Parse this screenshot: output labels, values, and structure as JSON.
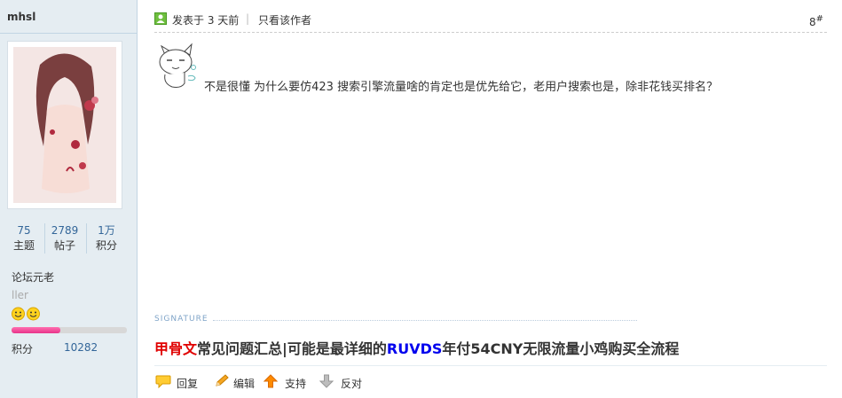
{
  "user": {
    "name": "mhsl",
    "stats": [
      {
        "value": "75",
        "label": "主题"
      },
      {
        "value": "2789",
        "label": "帖子"
      },
      {
        "value": "1万",
        "label": "积分"
      }
    ],
    "group": "论坛元老",
    "sub_label": "ller",
    "level_progress": 0.42,
    "points_label": "积分",
    "points_value": "10282"
  },
  "post": {
    "posted": "发表于 3 天前",
    "separator": "|",
    "author_only": "只看该作者",
    "floor_num": "8",
    "floor_suffix": "#",
    "body": "不是很懂 为什么要仿423 搜索引擎流量啥的肯定也是优先给它，老用户搜索也是，除非花钱买排名？"
  },
  "signature": {
    "label": "SIGNATURE",
    "part1": "甲骨文",
    "part2": "常见问题汇总|可能是最详细的",
    "part3": "RUVDS",
    "part4": "年付54CNY无限流量小鸡购买全流程"
  },
  "actions": {
    "reply": "回复",
    "edit": "编辑",
    "support": "支持",
    "oppose": "反对"
  },
  "colors": {
    "sidebar_bg": "#e5edf2",
    "link_blue": "#336699",
    "sig_red": "#e00000",
    "sig_blue": "#0000ee",
    "progress_pink": "#e8338a"
  }
}
